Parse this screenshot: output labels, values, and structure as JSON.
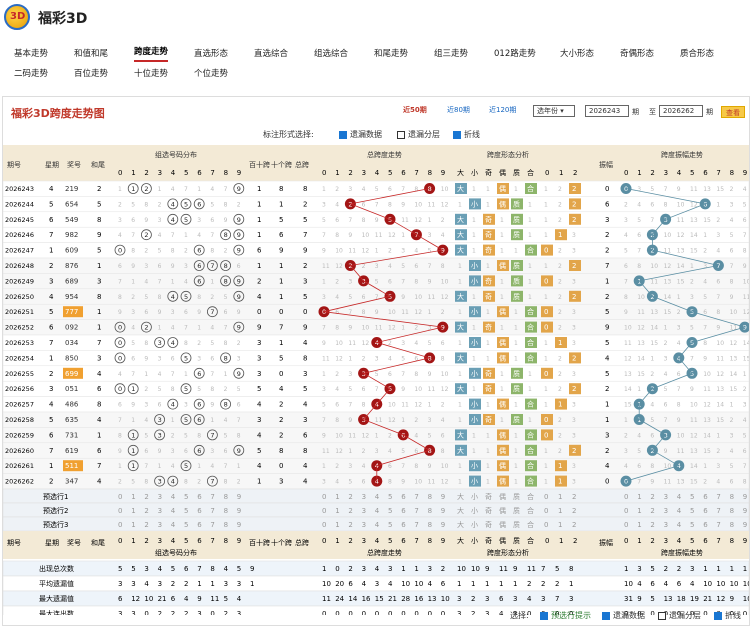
{
  "app": {
    "title": "福彩3D",
    "logo_text": "3D"
  },
  "nav": [
    "基本走势",
    "和值和尾",
    "跨度走势",
    "直选形态",
    "直选综合",
    "组选综合",
    "和尾走势",
    "组三走势",
    "012路走势",
    "大小形态",
    "奇偶形态",
    "质合形态",
    "二码走势",
    "百位走势",
    "十位走势",
    "个位走势"
  ],
  "nav_active": 2,
  "panel": {
    "title": "福彩3D跨度走势图",
    "recent": [
      "近50期",
      "近80期",
      "近120期"
    ],
    "select": "选年份",
    "from": "2026243",
    "to": "2026262",
    "qi": "期",
    "zhi": "至",
    "query": "查看"
  },
  "options": {
    "label": "标注形式选择:",
    "items": [
      {
        "label": "遗漏数据",
        "checked": true
      },
      {
        "label": "遗漏分层",
        "checked": false
      },
      {
        "label": "折线",
        "checked": true
      }
    ]
  },
  "table": {
    "header_groups": [
      "期号",
      "星期",
      "奖号",
      "和尾",
      "组选号码分布",
      "百十跨",
      "十个跨",
      "总跨",
      "总跨度走势",
      "跨度形态分析",
      "振幅",
      "跨度振幅走势"
    ],
    "form_labels": [
      "大",
      "小",
      "奇",
      "偶",
      "质",
      "合"
    ],
    "road_labels": [
      "0",
      "1",
      "2"
    ],
    "rows": [
      {
        "issue": "2026243",
        "week": "4",
        "num": "219",
        "tail": "2",
        "bs": "1",
        "sg": "8",
        "span": "8",
        "amp": "0"
      },
      {
        "issue": "2026244",
        "week": "5",
        "num": "654",
        "tail": "5",
        "bs": "1",
        "sg": "1",
        "span": "2",
        "amp": "6"
      },
      {
        "issue": "2026245",
        "week": "6",
        "num": "549",
        "tail": "8",
        "bs": "1",
        "sg": "5",
        "span": "5",
        "amp": "3"
      },
      {
        "issue": "2026246",
        "week": "7",
        "num": "982",
        "tail": "9",
        "bs": "1",
        "sg": "6",
        "span": "7",
        "amp": "2"
      },
      {
        "issue": "2026247",
        "week": "1",
        "num": "609",
        "tail": "5",
        "bs": "6",
        "sg": "9",
        "span": "9",
        "amp": "2"
      },
      {
        "issue": "2026248",
        "week": "2",
        "num": "876",
        "tail": "1",
        "bs": "1",
        "sg": "1",
        "span": "2",
        "amp": "7"
      },
      {
        "issue": "2026249",
        "week": "3",
        "num": "689",
        "tail": "3",
        "bs": "2",
        "sg": "1",
        "span": "3",
        "amp": "1"
      },
      {
        "issue": "2026250",
        "week": "4",
        "num": "954",
        "tail": "8",
        "bs": "4",
        "sg": "1",
        "span": "5",
        "amp": "2"
      },
      {
        "issue": "2026251",
        "week": "5",
        "num": "777",
        "tail": "1",
        "bs": "0",
        "sg": "0",
        "span": "0",
        "amp": "5",
        "hl": true
      },
      {
        "issue": "2026252",
        "week": "6",
        "num": "092",
        "tail": "1",
        "bs": "9",
        "sg": "7",
        "span": "9",
        "amp": "9"
      },
      {
        "issue": "2026253",
        "week": "7",
        "num": "034",
        "tail": "7",
        "bs": "3",
        "sg": "1",
        "span": "4",
        "amp": "5"
      },
      {
        "issue": "2026254",
        "week": "1",
        "num": "850",
        "tail": "3",
        "bs": "3",
        "sg": "5",
        "span": "8",
        "amp": "4"
      },
      {
        "issue": "2026255",
        "week": "2",
        "num": "699",
        "tail": "4",
        "bs": "3",
        "sg": "0",
        "span": "3",
        "amp": "5",
        "hl": true
      },
      {
        "issue": "2026256",
        "week": "3",
        "num": "051",
        "tail": "6",
        "bs": "5",
        "sg": "4",
        "span": "5",
        "amp": "2"
      },
      {
        "issue": "2026257",
        "week": "4",
        "num": "486",
        "tail": "8",
        "bs": "4",
        "sg": "2",
        "span": "4",
        "amp": "1"
      },
      {
        "issue": "2026258",
        "week": "5",
        "num": "635",
        "tail": "4",
        "bs": "3",
        "sg": "2",
        "span": "3",
        "amp": "1"
      },
      {
        "issue": "2026259",
        "week": "6",
        "num": "731",
        "tail": "1",
        "bs": "4",
        "sg": "2",
        "span": "6",
        "amp": "3"
      },
      {
        "issue": "2026260",
        "week": "7",
        "num": "619",
        "tail": "6",
        "bs": "5",
        "sg": "8",
        "span": "8",
        "amp": "2"
      },
      {
        "issue": "2026261",
        "week": "1",
        "num": "511",
        "tail": "7",
        "bs": "4",
        "sg": "0",
        "span": "4",
        "amp": "4",
        "hl": true
      },
      {
        "issue": "2026262",
        "week": "2",
        "num": "347",
        "tail": "4",
        "bs": "1",
        "sg": "3",
        "span": "4",
        "amp": "0"
      }
    ],
    "preselect": [
      "预选行1",
      "预选行2",
      "预选行3"
    ],
    "stats": [
      {
        "label": "出现总次数",
        "g": "5 5 3 4 5 6 7 8 4 5 9",
        "s": "1 0 2 3 4 3 1 1 3 2",
        "f": "10 10 9 11 9 11 7 5 8",
        "a": "1 3 5 2 2 3 1 1 1 1"
      },
      {
        "label": "平均遗漏值",
        "g": "3 3 4 3 2 2 1 1 3 3 1",
        "s": "10 20 6 4 3 4 10 10 4 6",
        "f": "1 1 1 1 1 2 2 2 1",
        "a": "10 4 6 4 6 4 10 10 10 10"
      },
      {
        "label": "最大遗漏值",
        "g": "6 12 10 21 6 4 9 11 5 4",
        "s": "11 24 14 16 15 21 28 16 13 10",
        "f": "3 2 3 6 3 4 3 7 3",
        "a": "31 9 5 13 18 19 21 12 9 10"
      },
      {
        "label": "最大连出数",
        "g": "3 3 0 2 2 2 3 0 2 3",
        "s": "0 0 0 0 0 0 0 0 0 0",
        "f": "3 2 3 4 3 0 0 0 0",
        "a": "0 0 0 0 0 0 0 0 0 0"
      }
    ]
  },
  "footer": {
    "label": "选择:",
    "items": [
      {
        "label": "预选行提示",
        "checked": true
      },
      {
        "label": "遗漏数据",
        "checked": true
      },
      {
        "label": "遗漏分层",
        "checked": false
      },
      {
        "label": "折线",
        "checked": true
      }
    ]
  }
}
